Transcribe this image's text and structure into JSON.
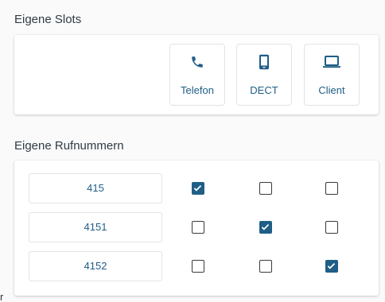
{
  "own_slots": {
    "title": "Eigene Slots",
    "slots": [
      {
        "label": "Telefon",
        "icon": "phone-icon"
      },
      {
        "label": "DECT",
        "icon": "mobile-phone-icon"
      },
      {
        "label": "Client",
        "icon": "laptop-icon"
      }
    ]
  },
  "own_numbers": {
    "title": "Eigene Rufnummern",
    "rows": [
      {
        "number": "415",
        "checks": [
          true,
          false,
          false
        ]
      },
      {
        "number": "4151",
        "checks": [
          false,
          true,
          false
        ]
      },
      {
        "number": "4152",
        "checks": [
          false,
          false,
          true
        ]
      }
    ]
  },
  "colors": {
    "accent": "#1f5e86"
  },
  "stray_char": "r"
}
